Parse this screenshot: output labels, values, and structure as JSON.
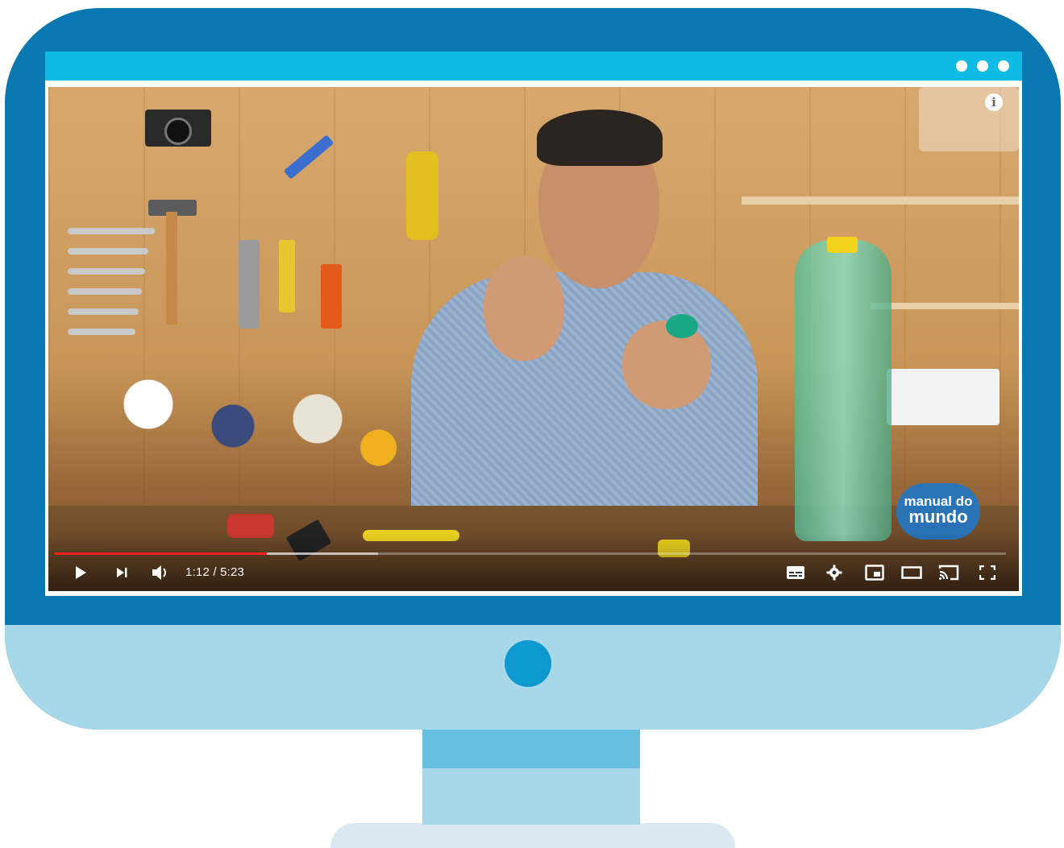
{
  "browser": {
    "menu_icon": "more-dots-icon"
  },
  "video": {
    "progress_played_fraction": 0.223,
    "progress_loaded_fraction": 0.34,
    "overlay_logo": {
      "line1": "manual do",
      "line2": "mundo"
    },
    "info_icon_label": "i"
  },
  "player_controls": {
    "time_display": "1:12 / 5:23",
    "icons": {
      "play": "play-icon",
      "next": "next-icon",
      "volume": "volume-icon",
      "subtitles": "subtitles-icon",
      "settings": "settings-icon",
      "miniplayer": "miniplayer-icon",
      "theater": "theater-icon",
      "cast": "cast-icon",
      "fullscreen": "fullscreen-icon"
    }
  },
  "colors": {
    "monitor_frame": "#0a78b0",
    "monitor_chin": "#a7d8ea",
    "browser_bar": "#0dbbe5",
    "progress_played": "#ff1f1f",
    "power_button": "#0d98d0"
  }
}
